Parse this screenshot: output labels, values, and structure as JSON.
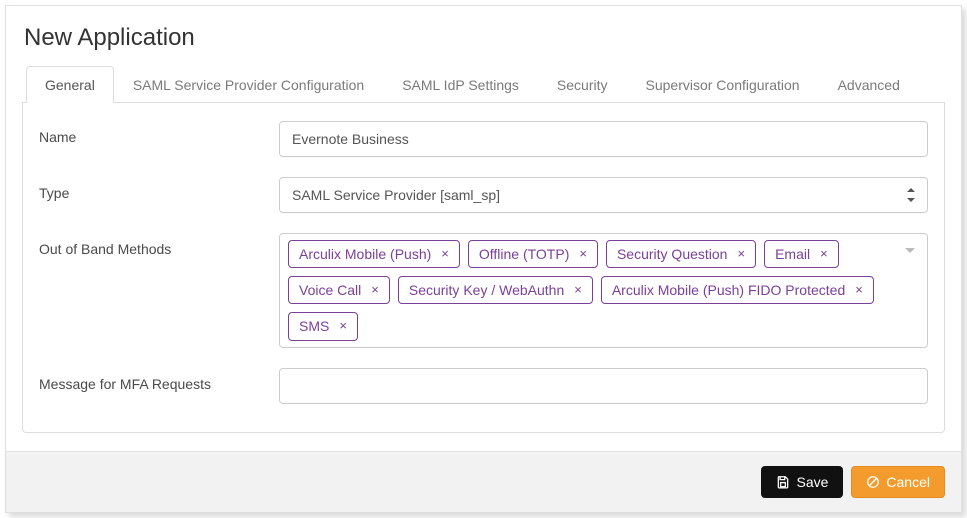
{
  "pageTitle": "New Application",
  "tabs": [
    {
      "label": "General",
      "active": true
    },
    {
      "label": "SAML Service Provider Configuration",
      "active": false
    },
    {
      "label": "SAML IdP Settings",
      "active": false
    },
    {
      "label": "Security",
      "active": false
    },
    {
      "label": "Supervisor Configuration",
      "active": false
    },
    {
      "label": "Advanced",
      "active": false
    }
  ],
  "form": {
    "nameLabel": "Name",
    "nameValue": "Evernote Business",
    "typeLabel": "Type",
    "typeValue": "SAML Service Provider [saml_sp]",
    "oobLabel": "Out of Band Methods",
    "oobTags": [
      "Arculix Mobile (Push)",
      "Offline (TOTP)",
      "Security Question",
      "Email",
      "Voice Call",
      "Security Key / WebAuthn",
      "Arculix Mobile (Push) FIDO Protected",
      "SMS"
    ],
    "mfaMsgLabel": "Message for MFA Requests",
    "mfaMsgValue": ""
  },
  "footer": {
    "saveLabel": "Save",
    "cancelLabel": "Cancel"
  }
}
